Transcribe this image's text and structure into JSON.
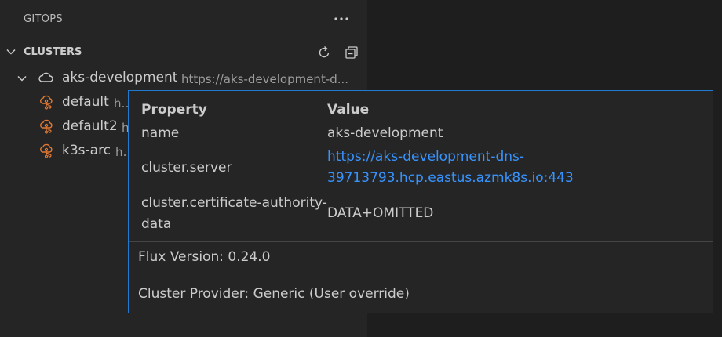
{
  "sidebar": {
    "title": "GITOPS",
    "more_label": "···"
  },
  "clusters_section": {
    "title": "CLUSTERS",
    "actions": [
      {
        "icon": "refresh-icon"
      },
      {
        "icon": "collapse-all-icon"
      }
    ]
  },
  "tree": {
    "root": {
      "label": "aks-development",
      "description": "https://aks-development-d...",
      "icon": "cloud-icon"
    },
    "children": [
      {
        "label": "default",
        "description": "htt",
        "icon": "gitops-cloud-icon"
      },
      {
        "label": "default2",
        "description": "h",
        "icon": "gitops-cloud-icon"
      },
      {
        "label": "k3s-arc",
        "description": "htt",
        "icon": "gitops-cloud-icon"
      }
    ]
  },
  "hover": {
    "headers": {
      "property": "Property",
      "value": "Value"
    },
    "rows": [
      {
        "property": "name",
        "value": "aks-development"
      },
      {
        "property_line1": "cluster.server",
        "value_line1": "https://aks-development-dns-",
        "value_line2": "39713793.hcp.eastus.azmk8s.io:443"
      },
      {
        "property_line1": "cluster.certificate-authority-",
        "property_line2": "data",
        "value": "DATA+OMITTED"
      }
    ],
    "flux_version": "Flux Version: 0.24.0",
    "cluster_provider": "Cluster Provider: Generic (User override)"
  },
  "colors": {
    "link": "#3794ff",
    "icon_orange": "#e37933",
    "hover_border": "#1f7ad2"
  }
}
